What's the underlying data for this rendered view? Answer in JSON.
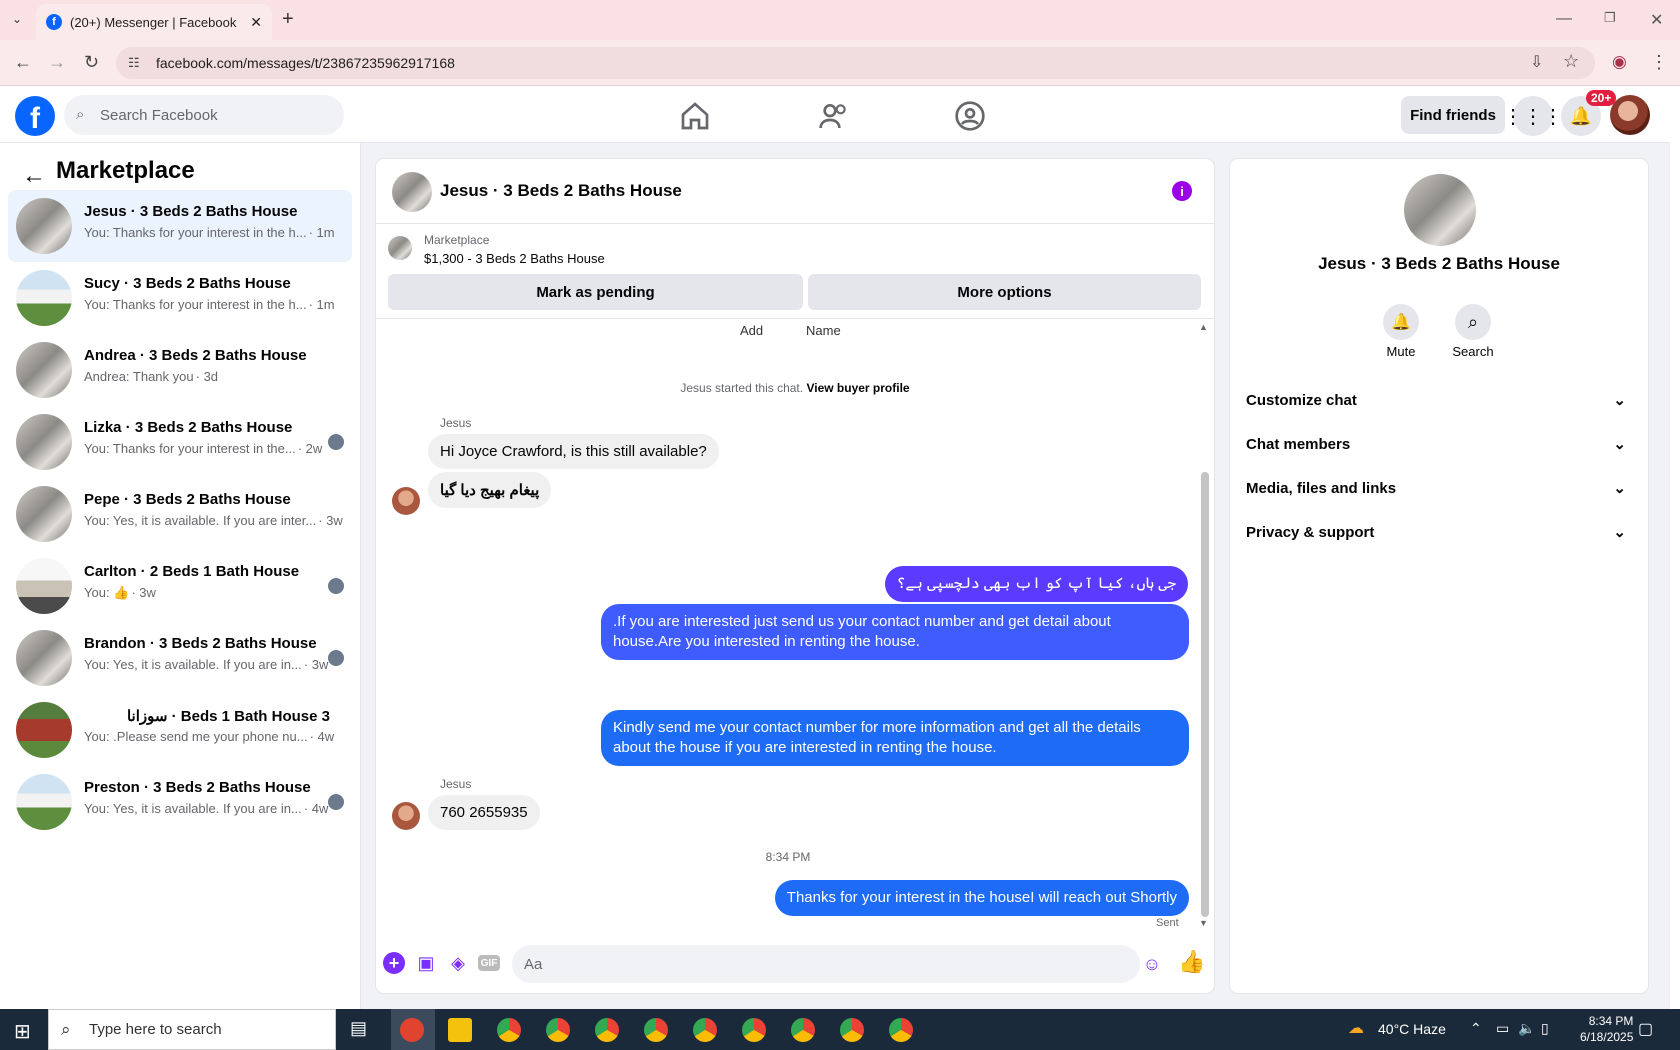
{
  "browser": {
    "tab_title": "(20+) Messenger | Facebook",
    "url": "facebook.com/messages/t/23867235962917168"
  },
  "fb": {
    "search_placeholder": "Search Facebook",
    "find_friends": "Find friends",
    "notif_badge": "20+"
  },
  "left": {
    "title": "Marketplace",
    "conversations": [
      {
        "title": "Jesus · 3 Beds 2 Baths House",
        "preview": "You: Thanks for your interest in the h...",
        "time": "· 1m",
        "selected": true
      },
      {
        "title": "Sucy · 3 Beds 2 Baths House",
        "preview": "You: Thanks for your interest in the h...",
        "time": "· 1m"
      },
      {
        "title": "Andrea · 3 Beds 2 Baths House",
        "preview": "Andrea: Thank you",
        "time": "· 3d"
      },
      {
        "title": "Lizka · 3 Beds 2 Baths House",
        "preview": "You: Thanks for your interest in the...",
        "time": "· 2w"
      },
      {
        "title": "Pepe · 3 Beds 2 Baths House",
        "preview": "You: Yes, it is available. If you are inter...",
        "time": "· 3w"
      },
      {
        "title": "Carlton · 2 Beds 1 Bath House",
        "preview": "You: 👍",
        "time": "· 3w"
      },
      {
        "title": "Brandon · 3 Beds 2 Baths House",
        "preview": "You: Yes, it is available. If you are in...",
        "time": "· 3w"
      },
      {
        "title": "Beds 1 Bath House 3 · سوزانا",
        "preview": "You: .Please send me your phone nu...",
        "time": "· 4w"
      },
      {
        "title": "Preston · 3 Beds 2 Baths House",
        "preview": "You: Yes, it is available. If you are in...",
        "time": "· 4w"
      }
    ]
  },
  "chat": {
    "title": "Jesus · 3 Beds 2 Baths House",
    "marketplace_label": "Marketplace",
    "listing": "$1,300 - 3 Beds 2 Baths House",
    "mark_pending": "Mark as pending",
    "more_options": "More options",
    "add_label": "Add",
    "name_label": "Name",
    "started_text": "Jesus started this chat.",
    "view_buyer": "View buyer profile",
    "sender": "Jesus",
    "msg_in_1": "Hi Joyce Crawford, is this still available?",
    "msg_in_2": "پیغام بھیج دیا گیا",
    "msg_out_1": "جی ہاں، کیا آپ کو اب بھی دلچسپی ہے؟",
    "msg_out_2": ".If you are interested just send us your contact number and get detail about house.Are you interested in renting the house.",
    "msg_out_3": "Kindly send me your contact number for more information and get all the details about the house if you are interested in renting the house.",
    "msg_in_3": "760 2655935",
    "time": "8:34 PM",
    "msg_out_4": "Thanks for your interest in the houseI will reach out Shortly",
    "sent": "Sent",
    "composer_placeholder": "Aa"
  },
  "right": {
    "name": "Jesus · 3 Beds 2 Baths House",
    "mute": "Mute",
    "search": "Search",
    "items": [
      "Customize chat",
      "Chat members",
      "Media, files and links",
      "Privacy & support"
    ]
  },
  "taskbar": {
    "search_placeholder": "Type here to search",
    "weather": "40°C  Haze",
    "time": "8:34 PM",
    "date": "6/18/2025"
  },
  "colors": {
    "accent": "#0866ff",
    "bubble_out": "#5d3aff",
    "info": "#9b00e8"
  }
}
